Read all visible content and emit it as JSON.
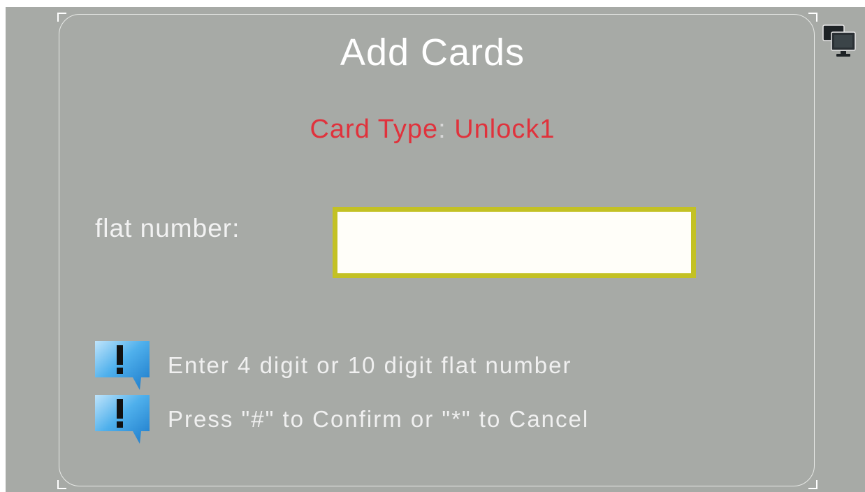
{
  "dialog": {
    "title": "Add Cards",
    "card_type_label": "Card Type",
    "card_type_separator": ":",
    "card_type_value": "Unlock1"
  },
  "form": {
    "flat_number_label": "flat number:",
    "flat_number_value": ""
  },
  "hints": [
    {
      "icon": "exclamation-callout-icon",
      "text": "Enter 4 digit or 10 digit flat number"
    },
    {
      "icon": "exclamation-callout-icon",
      "text": "Press \"#\" to Confirm or \"*\" to Cancel"
    }
  ],
  "toolbar": {
    "icon": "monitor-icon"
  },
  "colors": {
    "screen_background": "#a7aaa6",
    "card_type_text": "#e0323c",
    "input_border": "#c3c124",
    "input_background": "#fffef9",
    "icon_blue": "#3a9ee0"
  }
}
